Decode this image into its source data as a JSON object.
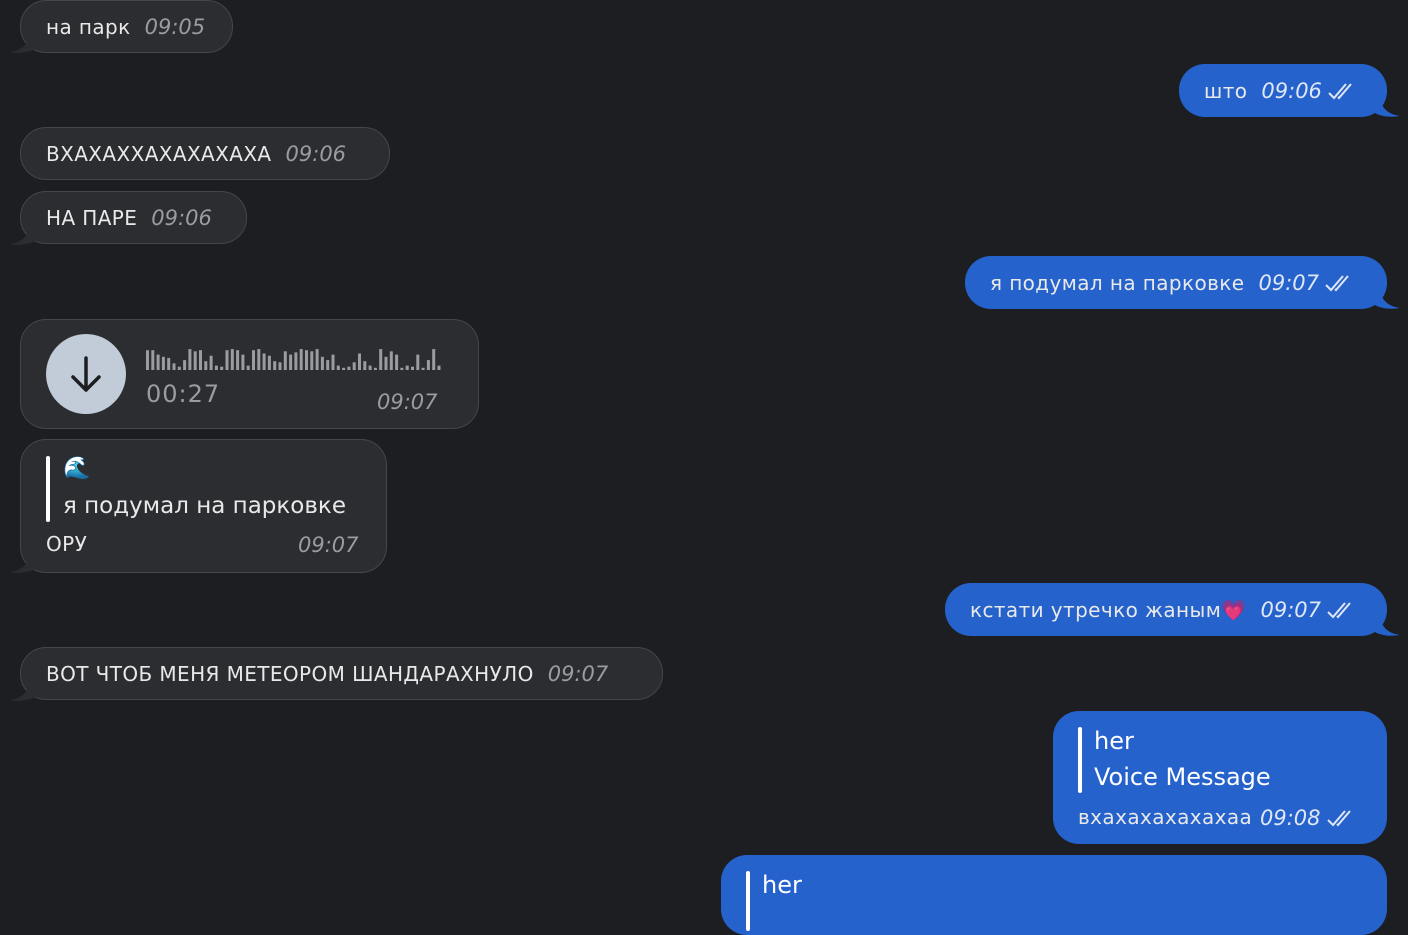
{
  "messages": [
    {
      "id": "m1",
      "dir": "in",
      "text": "на парк",
      "time": "09:05"
    },
    {
      "id": "m2",
      "dir": "out",
      "text": "што",
      "time": "09:06"
    },
    {
      "id": "m3",
      "dir": "in",
      "text": "ВХАХАХХАХАХАХАХА",
      "time": "09:06"
    },
    {
      "id": "m4",
      "dir": "in",
      "text": "НА ПАРЕ",
      "time": "09:06"
    },
    {
      "id": "m5",
      "dir": "out",
      "text": "я подумал на  парковке",
      "time": "09:07"
    },
    {
      "id": "m6",
      "dir": "in",
      "type": "voice",
      "duration": "00:27",
      "time": "09:07"
    },
    {
      "id": "m7",
      "dir": "in",
      "reply_emoji": "🌊",
      "reply_text": "я подумал на  парковке",
      "text": "ОРУ",
      "time": "09:07"
    },
    {
      "id": "m8",
      "dir": "out",
      "text": "кстати утречко жаным💗",
      "time": "09:07"
    },
    {
      "id": "m9",
      "dir": "in",
      "text": "ВОТ ЧТОБ МЕНЯ МЕТЕОРОМ ШАНДАРАХНУЛО",
      "time": "09:07"
    },
    {
      "id": "m10",
      "dir": "out",
      "reply_author": "her",
      "reply_text": "Voice Message",
      "text": "вхахахахахахаа",
      "time": "09:08"
    },
    {
      "id": "m11",
      "dir": "out",
      "reply_author": "her"
    }
  ],
  "voice_waveform": [
    0.9,
    0.9,
    0.7,
    0.6,
    0.55,
    0.3,
    0.15,
    0.45,
    0.95,
    0.85,
    0.9,
    0.4,
    0.65,
    0.2,
    0.15,
    0.9,
    0.95,
    0.9,
    0.7,
    0.2,
    0.9,
    0.95,
    0.75,
    0.65,
    0.4,
    0.35,
    0.85,
    0.7,
    0.8,
    0.95,
    0.9,
    0.85,
    0.95,
    0.6,
    0.45,
    0.7,
    0.2,
    0.1,
    0.15,
    0.35,
    0.75,
    0.4,
    0.2,
    0.1,
    0.95,
    0.6,
    0.85,
    0.7,
    0.1,
    0.2,
    0.15,
    0.7,
    0.1,
    0.45,
    0.95,
    0.2
  ],
  "colors": {
    "incoming_bg": "#2c2d30",
    "outgoing_bg": "#2562cc",
    "background": "#1c1e21"
  },
  "icons": {
    "download": "arrow-down-icon",
    "read_receipt": "double-check-icon"
  }
}
